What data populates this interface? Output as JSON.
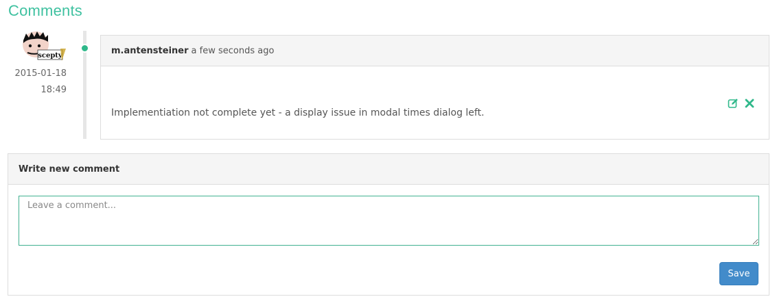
{
  "section": {
    "title": "Comments"
  },
  "comment": {
    "date": "2015-01-18",
    "time": "18:49",
    "author": "m.antensteiner",
    "relative_time": "a few seconds ago",
    "text": "Implementiation not complete yet - a display issue in modal times dialog left.",
    "avatar_text": "scepty",
    "actions": [
      {
        "name": "edit-icon"
      },
      {
        "name": "delete-icon"
      }
    ]
  },
  "new_comment": {
    "heading": "Write new comment",
    "placeholder": "Leave a comment...",
    "save_label": "Save"
  },
  "colors": {
    "accent": "#3fc1a0",
    "timeline_dot": "#2fb88a",
    "primary_button": "#428bca"
  }
}
